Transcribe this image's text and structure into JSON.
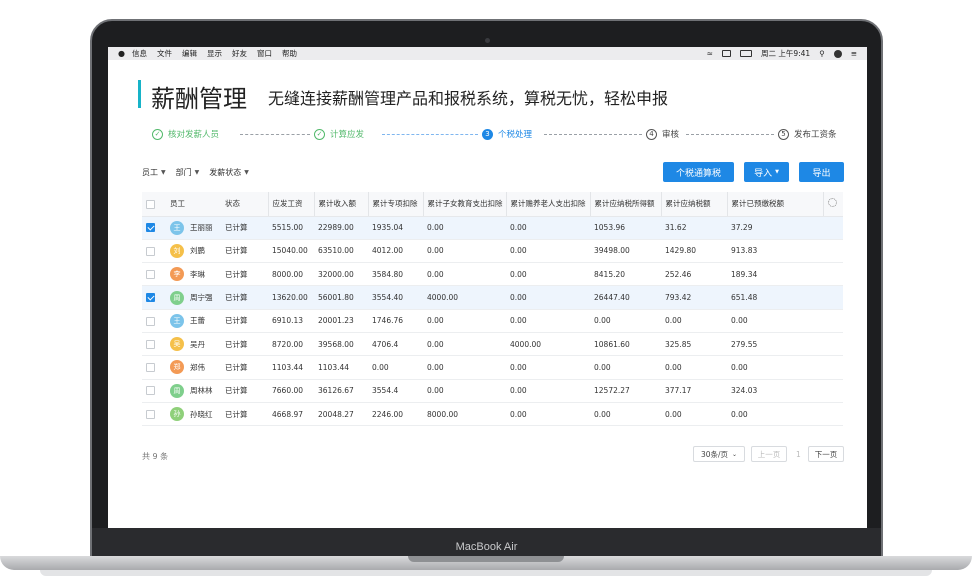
{
  "device": {
    "label": "MacBook Air"
  },
  "menubar": {
    "items": [
      "信息",
      "文件",
      "编辑",
      "显示",
      "好友",
      "窗口",
      "帮助"
    ],
    "clock": "周二 上午9:41"
  },
  "header": {
    "title": "薪酬管理",
    "subtitle": "无缝连接薪酬管理产品和报税系统，算税无忧，轻松申报"
  },
  "steps": [
    {
      "index": "✓",
      "label": "核对发薪人员",
      "state": "done"
    },
    {
      "index": "✓",
      "label": "计算应发",
      "state": "done"
    },
    {
      "index": "3",
      "label": "个税处理",
      "state": "active"
    },
    {
      "index": "4",
      "label": "审核",
      "state": "todo"
    },
    {
      "index": "5",
      "label": "发布工资条",
      "state": "todo"
    }
  ],
  "filters": {
    "employee": "员工",
    "department": "部门",
    "status": "发薪状态"
  },
  "actions": {
    "tax_calc": "个税通算税",
    "import": "导入",
    "export": "导出"
  },
  "colors": {
    "accent": "#17b3c8",
    "primary": "#1e88e5",
    "done": "#52b96b"
  },
  "table": {
    "columns": [
      "员工",
      "状态",
      "应发工资",
      "累计收入额",
      "累计专项扣除",
      "累计子女教育支出扣除",
      "累计赡养老人支出扣除",
      "累计应纳税所得额",
      "累计应纳税额",
      "累计已预缴税额"
    ],
    "rows": [
      {
        "checked": true,
        "avatar": "王",
        "avatar_color": "#7cc4ea",
        "name": "王丽丽",
        "status": "已计算",
        "salary": "5515.00",
        "income": "22989.00",
        "special": "1935.04",
        "child": "0.00",
        "elder": "0.00",
        "taxable": "1053.96",
        "tax": "31.62",
        "prepaid": "37.29"
      },
      {
        "checked": false,
        "avatar": "刘",
        "avatar_color": "#f5c04a",
        "name": "刘鹏",
        "status": "已计算",
        "salary": "15040.00",
        "income": "63510.00",
        "special": "4012.00",
        "child": "0.00",
        "elder": "0.00",
        "taxable": "39498.00",
        "tax": "1429.80",
        "prepaid": "913.83"
      },
      {
        "checked": false,
        "avatar": "李",
        "avatar_color": "#f39a55",
        "name": "李琳",
        "status": "已计算",
        "salary": "8000.00",
        "income": "32000.00",
        "special": "3584.80",
        "child": "0.00",
        "elder": "0.00",
        "taxable": "8415.20",
        "tax": "252.46",
        "prepaid": "189.34"
      },
      {
        "checked": true,
        "avatar": "周",
        "avatar_color": "#7fcf8c",
        "name": "周宁强",
        "status": "已计算",
        "salary": "13620.00",
        "income": "56001.80",
        "special": "3554.40",
        "child": "4000.00",
        "elder": "0.00",
        "taxable": "26447.40",
        "tax": "793.42",
        "prepaid": "651.48"
      },
      {
        "checked": false,
        "avatar": "王",
        "avatar_color": "#7cc4ea",
        "name": "王蕾",
        "status": "已计算",
        "salary": "6910.13",
        "income": "20001.23",
        "special": "1746.76",
        "child": "0.00",
        "elder": "0.00",
        "taxable": "0.00",
        "tax": "0.00",
        "prepaid": "0.00"
      },
      {
        "checked": false,
        "avatar": "吴",
        "avatar_color": "#f5c04a",
        "name": "吴丹",
        "status": "已计算",
        "salary": "8720.00",
        "income": "39568.00",
        "special": "4706.4",
        "child": "0.00",
        "elder": "4000.00",
        "taxable": "10861.60",
        "tax": "325.85",
        "prepaid": "279.55"
      },
      {
        "checked": false,
        "avatar": "郑",
        "avatar_color": "#f39a55",
        "name": "郑伟",
        "status": "已计算",
        "salary": "1103.44",
        "income": "1103.44",
        "special": "0.00",
        "child": "0.00",
        "elder": "0.00",
        "taxable": "0.00",
        "tax": "0.00",
        "prepaid": "0.00"
      },
      {
        "checked": false,
        "avatar": "周",
        "avatar_color": "#7fcf8c",
        "name": "周林林",
        "status": "已计算",
        "salary": "7660.00",
        "income": "36126.67",
        "special": "3554.4",
        "child": "0.00",
        "elder": "0.00",
        "taxable": "12572.27",
        "tax": "377.17",
        "prepaid": "324.03"
      },
      {
        "checked": false,
        "avatar": "孙",
        "avatar_color": "#8fd07a",
        "name": "孙晓红",
        "status": "已计算",
        "salary": "4668.97",
        "income": "20048.27",
        "special": "2246.00",
        "child": "8000.00",
        "elder": "0.00",
        "taxable": "0.00",
        "tax": "0.00",
        "prepaid": "0.00"
      }
    ]
  },
  "footer": {
    "total": "共 9 条",
    "page_size": "30条/页",
    "prev": "上一页",
    "page": "1",
    "next": "下一页"
  }
}
